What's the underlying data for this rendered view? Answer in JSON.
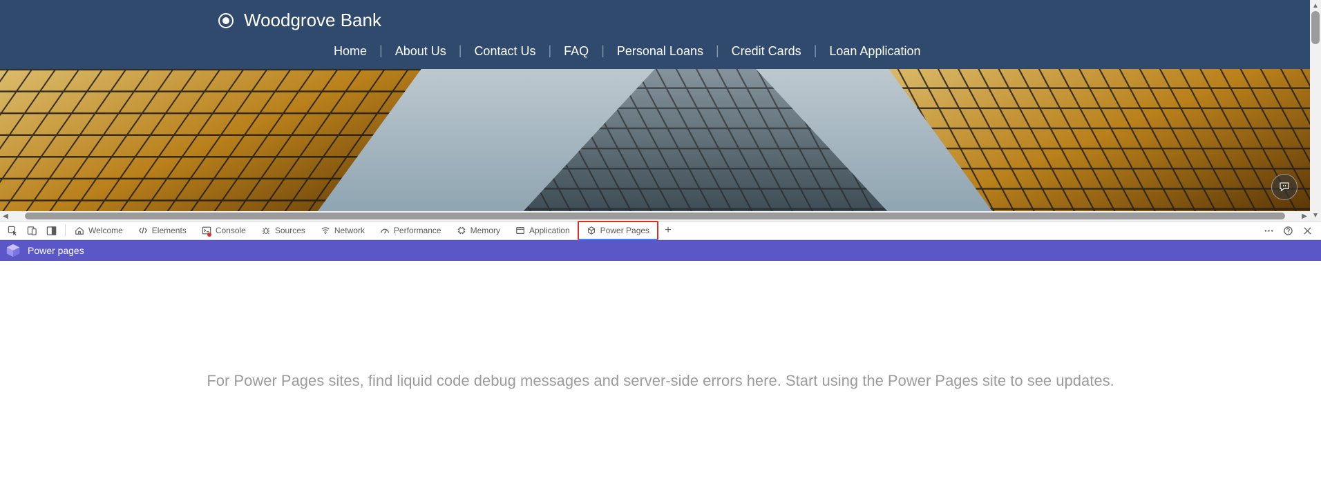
{
  "site": {
    "brand_name": "Woodgrove Bank",
    "nav": [
      "Home",
      "About Us",
      "Contact Us",
      "FAQ",
      "Personal Loans",
      "Credit Cards",
      "Loan Application"
    ]
  },
  "devtools": {
    "tabs": [
      {
        "id": "welcome",
        "label": "Welcome"
      },
      {
        "id": "elements",
        "label": "Elements"
      },
      {
        "id": "console",
        "label": "Console"
      },
      {
        "id": "sources",
        "label": "Sources"
      },
      {
        "id": "network",
        "label": "Network"
      },
      {
        "id": "performance",
        "label": "Performance"
      },
      {
        "id": "memory",
        "label": "Memory"
      },
      {
        "id": "application",
        "label": "Application"
      },
      {
        "id": "powerpages",
        "label": "Power Pages",
        "active": true
      }
    ]
  },
  "powerpages": {
    "header_label": "Power pages",
    "message": "For Power Pages sites, find liquid code debug messages and server-side errors here. Start using the Power Pages site to see updates."
  }
}
